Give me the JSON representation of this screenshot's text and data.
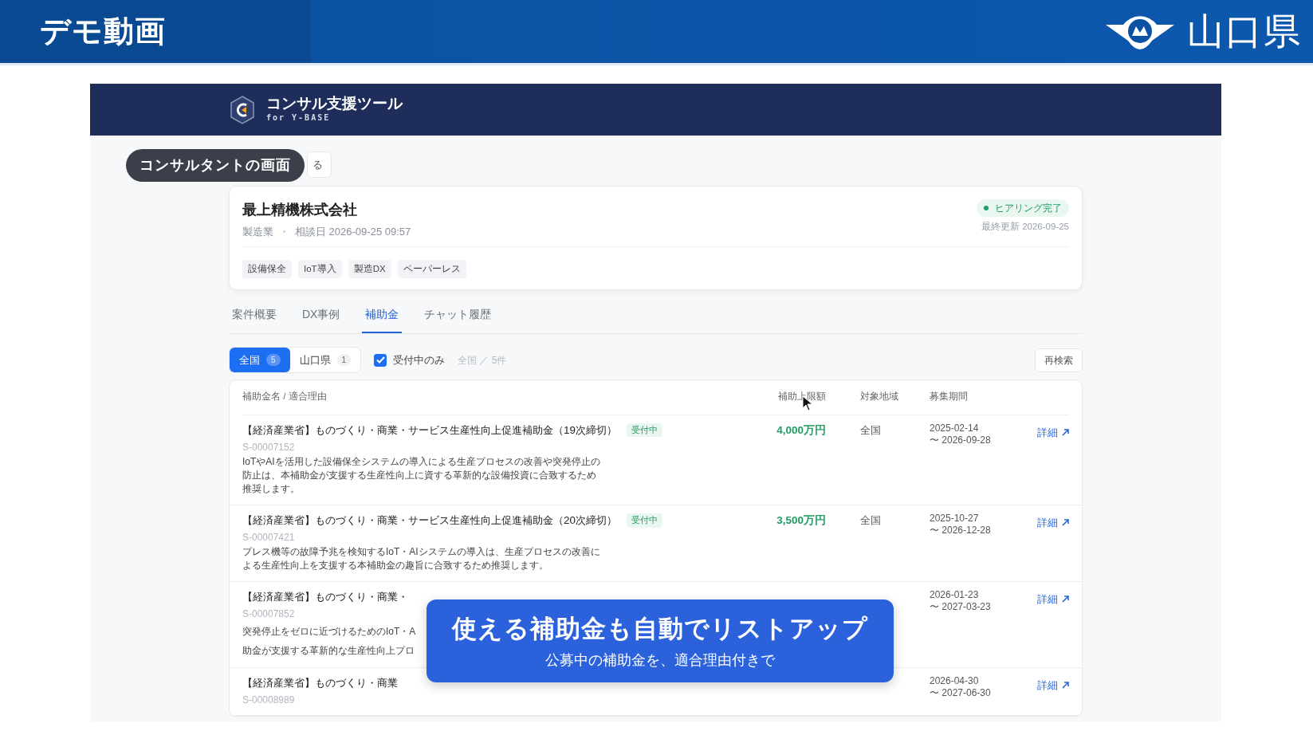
{
  "banner": {
    "title": "デモ動画",
    "logo_text": "山口県"
  },
  "app": {
    "title": "コンサル支援ツール",
    "subtitle": "for Y-BASE"
  },
  "screen_label": "コンサルタントの画面",
  "back_button": "る",
  "company": {
    "name": "最上精機株式会社",
    "industry": "製造業",
    "consult_date": "相談日 2026-09-25 09:57",
    "status": "ヒアリング完了",
    "updated": "最終更新 2026-09-25",
    "tags": [
      "設備保全",
      "IoT導入",
      "製造DX",
      "ペーパーレス"
    ]
  },
  "tabs": [
    {
      "label": "案件概要",
      "selected": false
    },
    {
      "label": "DX事例",
      "selected": false
    },
    {
      "label": "補助金",
      "selected": true
    },
    {
      "label": "チャット履歴",
      "selected": false
    }
  ],
  "region_filters": [
    {
      "label": "全国",
      "count": "5",
      "selected": true
    },
    {
      "label": "山口県",
      "count": "1",
      "selected": false
    }
  ],
  "open_only": {
    "label": "受付中のみ",
    "checked": true
  },
  "result_summary": "全国 ／ 5件",
  "research_button": "再検索",
  "table": {
    "columns": [
      "補助金名 / 適合理由",
      "補助上限額",
      "対象地域",
      "募集期間"
    ],
    "rows": [
      {
        "title": "【経済産業省】ものづくり・商業・サービス生産性向上促進補助金（19次締切）",
        "status": "受付中",
        "code": "S-00007152",
        "reason": "IoTやAIを活用した設備保全システムの導入による生産プロセスの改善や突発停止の防止は、本補助金が支援する生産性向上に資する革新的な設備投資に合致するため推奨します。",
        "amount": "4,000万円",
        "region": "全国",
        "period_start": "2025-02-14",
        "period_end": "〜 2026-09-28",
        "link": "詳細"
      },
      {
        "title": "【経済産業省】ものづくり・商業・サービス生産性向上促進補助金（20次締切）",
        "status": "受付中",
        "code": "S-00007421",
        "reason": "プレス機等の故障予兆を検知するIoT・AIシステムの導入は、生産プロセスの改善による生産性向上を支援する本補助金の趣旨に合致するため推奨します。",
        "amount": "3,500万円",
        "region": "全国",
        "period_start": "2025-10-27",
        "period_end": "〜 2026-12-28",
        "link": "詳細"
      },
      {
        "title": "【経済産業省】ものづくり・商業・",
        "code": "S-00007852",
        "reason_fragments": [
          "突発停止をゼロに近づけるためのIoT・A",
          "助金が支援する革新的な生産性向上プロ"
        ],
        "period_start": "2026-01-23",
        "period_end": "〜 2027-03-23",
        "link": "詳細"
      },
      {
        "title": "【経済産業省】ものづくり・商業",
        "code": "S-00008989",
        "period_start": "2026-04-30",
        "period_end": "〜 2027-06-30",
        "link": "詳細"
      }
    ]
  },
  "caption": {
    "title": "使える補助金も自動でリストアップ",
    "subtitle": "公募中の補助金を、適合理由付きで"
  }
}
